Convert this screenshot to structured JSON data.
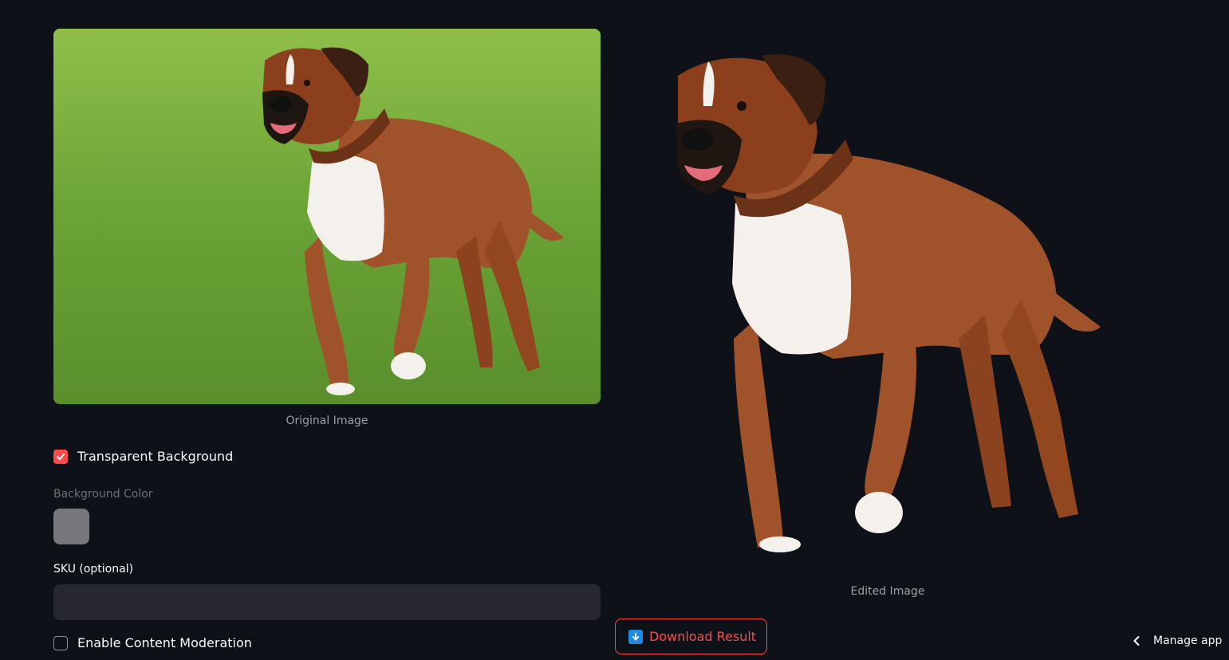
{
  "left": {
    "original_caption": "Original Image",
    "transparent_bg": {
      "label": "Transparent Background",
      "checked": true
    },
    "bg_color": {
      "label": "Background Color",
      "value": "#76777b"
    },
    "sku": {
      "label": "SKU (optional)",
      "value": "",
      "placeholder": ""
    },
    "moderation": {
      "label": "Enable Content Moderation",
      "checked": false
    }
  },
  "right": {
    "edited_caption": "Edited Image",
    "download_label": "Download Result",
    "download_icon": "arrow-down-box-icon"
  },
  "footer": {
    "manage_app_label": "Manage app",
    "manage_icon": "chevron-left-icon"
  },
  "colors": {
    "background": "#0e1117",
    "accent": "#ff4b4b",
    "input_bg": "#262730",
    "grass": "#6fa83a",
    "dog_coat": "#a0532a"
  }
}
